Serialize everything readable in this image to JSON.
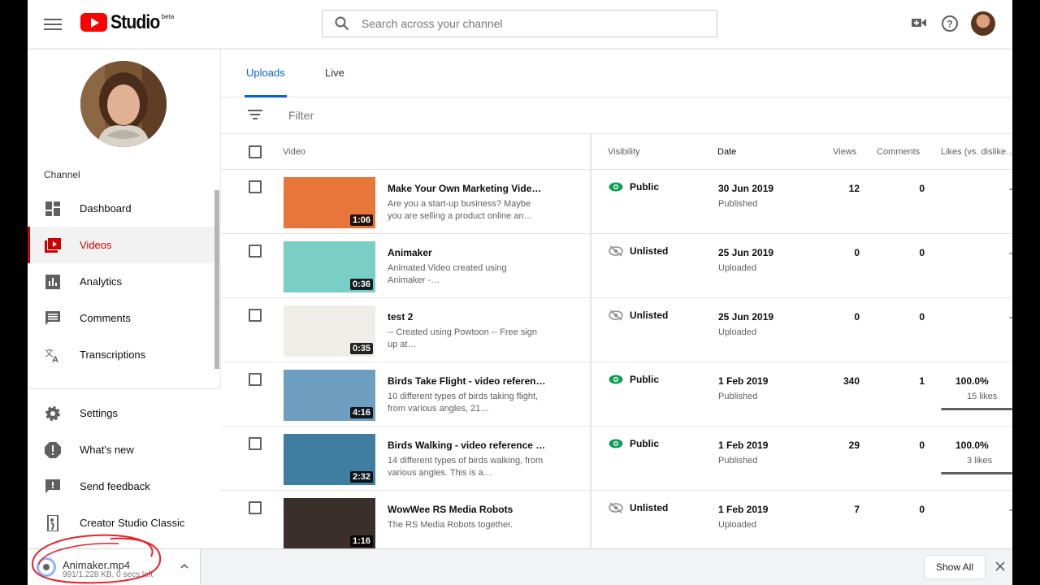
{
  "header": {
    "logo_text": "Studio",
    "logo_beta": "beta",
    "search_placeholder": "Search across your channel"
  },
  "sidebar": {
    "section_label": "Channel",
    "items": [
      {
        "label": "Dashboard",
        "icon": "dashboard-icon"
      },
      {
        "label": "Videos",
        "icon": "videos-icon",
        "active": true
      },
      {
        "label": "Analytics",
        "icon": "analytics-icon"
      },
      {
        "label": "Comments",
        "icon": "comments-icon"
      },
      {
        "label": "Transcriptions",
        "icon": "translate-icon"
      }
    ],
    "bottom_items": [
      {
        "label": "Settings",
        "icon": "gear-icon"
      },
      {
        "label": "What's new",
        "icon": "alert-icon"
      },
      {
        "label": "Send feedback",
        "icon": "feedback-icon"
      },
      {
        "label": "Creator Studio Classic",
        "icon": "exit-icon"
      }
    ]
  },
  "tabs": [
    {
      "label": "Uploads",
      "active": true
    },
    {
      "label": "Live"
    }
  ],
  "filter": {
    "label": "Filter"
  },
  "table": {
    "columns": {
      "video": "Video",
      "visibility": "Visibility",
      "date": "Date",
      "views": "Views",
      "comments": "Comments",
      "likes": "Likes (vs. dislike…"
    },
    "rows": [
      {
        "title": "Make Your Own Marketing Video…",
        "desc": "Are you a start-up business? Maybe you are selling a product online an…",
        "duration": "1:06",
        "visibility": "Public",
        "date": "30 Jun 2019",
        "status": "Published",
        "views": "12",
        "comments": "0",
        "likes_pct": "",
        "likes_count": "",
        "thumb_color": "#e8763a"
      },
      {
        "title": "Animaker",
        "desc": "Animated Video created using Animaker -…",
        "duration": "0:36",
        "visibility": "Unlisted",
        "date": "25 Jun 2019",
        "status": "Uploaded",
        "views": "0",
        "comments": "0",
        "likes_pct": "",
        "likes_count": "",
        "thumb_color": "#79cfc6"
      },
      {
        "title": "test 2",
        "desc": "-- Created using Powtoon -- Free sign up at…",
        "duration": "0:35",
        "visibility": "Unlisted",
        "date": "25 Jun 2019",
        "status": "Uploaded",
        "views": "0",
        "comments": "0",
        "likes_pct": "",
        "likes_count": "",
        "thumb_color": "#efeee8"
      },
      {
        "title": "Birds Take Flight - video referen…",
        "desc": "10 different types of birds taking flight, from various angles, 21…",
        "duration": "4:16",
        "visibility": "Public",
        "date": "1 Feb 2019",
        "status": "Published",
        "views": "340",
        "comments": "1",
        "likes_pct": "100.0%",
        "likes_count": "15 likes",
        "thumb_color": "#6f9fc0"
      },
      {
        "title": "Birds Walking - video reference f…",
        "desc": "14 different types of birds walking, from various angles. This is a…",
        "duration": "2:32",
        "visibility": "Public",
        "date": "1 Feb 2019",
        "status": "Published",
        "views": "29",
        "comments": "0",
        "likes_pct": "100.0%",
        "likes_count": "3 likes",
        "thumb_color": "#3f7ea0"
      },
      {
        "title": "WowWee RS Media Robots",
        "desc": "The RS Media Robots together.",
        "duration": "1:16",
        "visibility": "Unlisted",
        "date": "1 Feb 2019",
        "status": "Uploaded",
        "views": "7",
        "comments": "0",
        "likes_pct": "",
        "likes_count": "",
        "thumb_color": "#3a2f2a"
      }
    ]
  },
  "download_bar": {
    "filename": "Animaker.mp4",
    "meta": "991/1,228 KB, 0 secs left",
    "show_all": "Show All"
  },
  "colors": {
    "brand_red": "#ff0000",
    "active_red": "#cc0000",
    "link_blue": "#065fd4",
    "public_green": "#0f9d58"
  }
}
